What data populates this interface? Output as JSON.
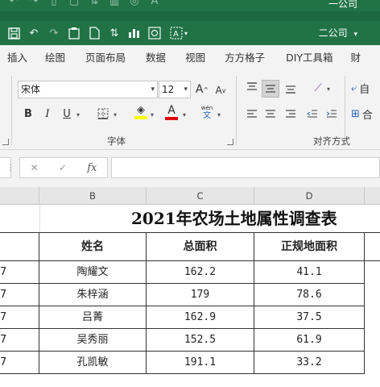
{
  "titlebar": {
    "company": "二公司",
    "company_ghost": "一公司",
    "company_dropdown": "▾"
  },
  "qat_icons": [
    "save-icon",
    "undo-icon",
    "redo-icon",
    "clipboard-icon",
    "new-file-icon",
    "sort-icon",
    "chart-icon",
    "preview-icon",
    "text-box-icon"
  ],
  "tabs": [
    "插入",
    "绘图",
    "页面布局",
    "数据",
    "视图",
    "方方格子",
    "DIY工具箱",
    "财"
  ],
  "ribbon": {
    "font_name": "宋体",
    "font_size": "12",
    "bold": "B",
    "italic": "I",
    "underline": "U",
    "grow_font": "A",
    "shrink_font": "A",
    "font_color_letter": "A",
    "phonetic": "wén",
    "phonetic_sub": "文",
    "font_group": "字体",
    "align_group": "对齐方式",
    "wrap_label": "自",
    "merge_label": "合",
    "colors": {
      "fill": "#ffff00",
      "font": "#e00000"
    }
  },
  "formula_bar": {
    "fx": "fx",
    "value": ""
  },
  "columns": [
    "B",
    "C",
    "D"
  ],
  "sheet": {
    "title": "2021年农场土地属性调查表",
    "headers": [
      "姓名",
      "总面积",
      "正规地面积"
    ],
    "row_stub": "7",
    "rows": [
      {
        "name": "陶耀文",
        "total": "162.2",
        "regular": "41.1"
      },
      {
        "name": "朱梓涵",
        "total": "179",
        "regular": "78.6"
      },
      {
        "name": "吕菁",
        "total": "162.9",
        "regular": "37.5"
      },
      {
        "name": "吴秀丽",
        "total": "152.5",
        "regular": "61.9"
      },
      {
        "name": "孔凯敏",
        "total": "191.1",
        "regular": "33.2"
      }
    ]
  }
}
